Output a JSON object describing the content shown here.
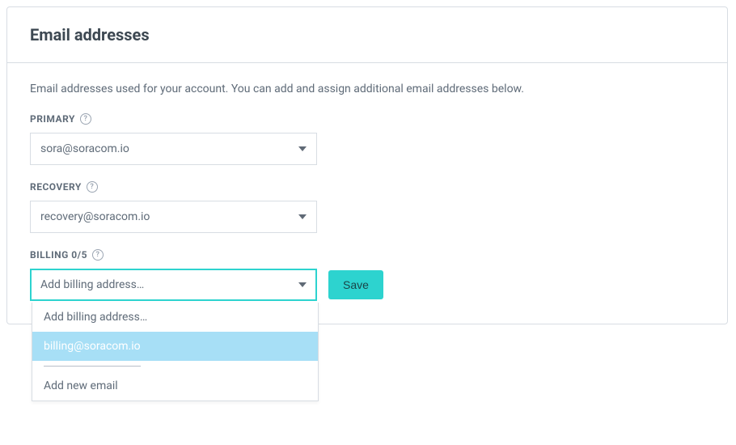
{
  "panel": {
    "title": "Email addresses",
    "description": "Email addresses used for your account. You can add and assign additional email addresses below."
  },
  "primary": {
    "label": "PRIMARY",
    "value": "sora@soracom.io"
  },
  "recovery": {
    "label": "RECOVERY",
    "value": "recovery@soracom.io"
  },
  "billing": {
    "label": "BILLING 0/5",
    "placeholder": "Add billing address…",
    "save": "Save",
    "options": {
      "placeholder": "Add billing address…",
      "highlighted": "billing@soracom.io",
      "addNew": "Add new email"
    }
  }
}
